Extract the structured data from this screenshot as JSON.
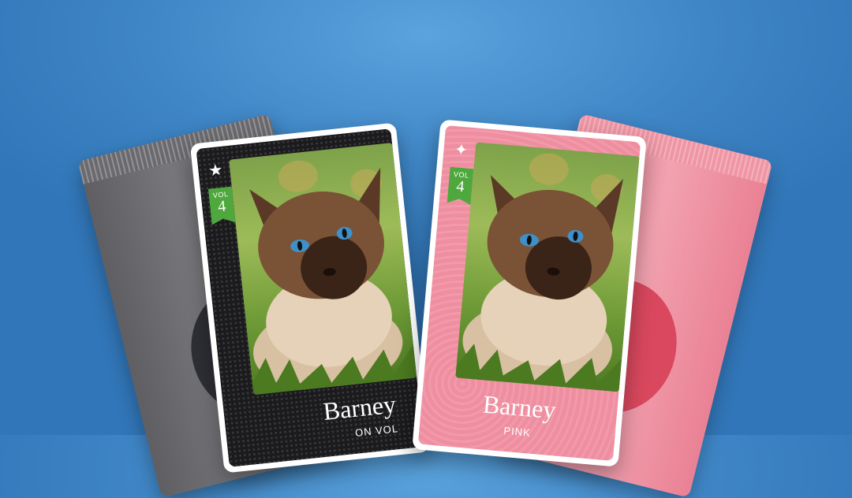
{
  "packs": [
    {
      "name": "gray-pack",
      "color": "#6e6e72"
    },
    {
      "name": "pink-pack",
      "color": "#f09aa9"
    }
  ],
  "cards": [
    {
      "theme": "black",
      "rank_icon": "star-icon",
      "rank_glyph": "★",
      "vol_label": "VOL",
      "vol_number": "4",
      "name": "Barney",
      "subtitle": "ON VOL"
    },
    {
      "theme": "pink",
      "rank_icon": "sparkle-icon",
      "rank_glyph": "✦",
      "vol_label": "VOL",
      "vol_number": "4",
      "name": "Barney",
      "subtitle": "PINK"
    }
  ],
  "colors": {
    "background": "#4a92d2",
    "ribbon_green": "#4fa83d",
    "pink_card": "#ef8ea0",
    "black_card": "#1b1b1d"
  }
}
